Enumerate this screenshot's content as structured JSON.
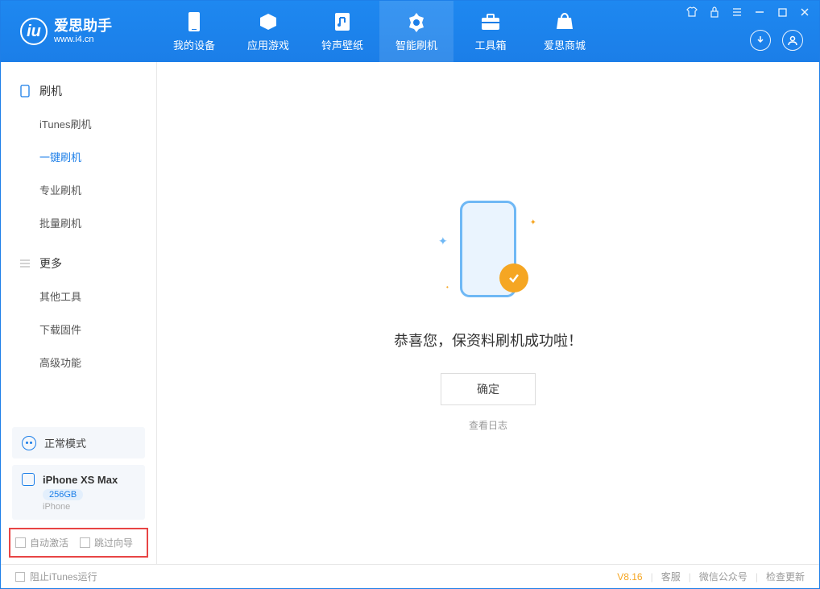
{
  "logo": {
    "title": "爱思助手",
    "url": "www.i4.cn"
  },
  "nav": {
    "tabs": [
      {
        "label": "我的设备",
        "icon": "device-icon"
      },
      {
        "label": "应用游戏",
        "icon": "apps-icon"
      },
      {
        "label": "铃声壁纸",
        "icon": "ringtone-icon"
      },
      {
        "label": "智能刷机",
        "icon": "flash-icon",
        "active": true
      },
      {
        "label": "工具箱",
        "icon": "toolbox-icon"
      },
      {
        "label": "爱思商城",
        "icon": "store-icon"
      }
    ]
  },
  "sidebar": {
    "group1": {
      "title": "刷机"
    },
    "items1": [
      {
        "label": "iTunes刷机"
      },
      {
        "label": "一键刷机",
        "active": true
      },
      {
        "label": "专业刷机"
      },
      {
        "label": "批量刷机"
      }
    ],
    "group2": {
      "title": "更多"
    },
    "items2": [
      {
        "label": "其他工具"
      },
      {
        "label": "下载固件"
      },
      {
        "label": "高级功能"
      }
    ],
    "mode": {
      "label": "正常模式"
    },
    "device": {
      "name": "iPhone XS Max",
      "capacity": "256GB",
      "type": "iPhone"
    },
    "checkboxes": {
      "auto_activate": "自动激活",
      "skip_guide": "跳过向导"
    }
  },
  "main": {
    "success_title": "恭喜您，保资料刷机成功啦！",
    "ok_button": "确定",
    "view_log": "查看日志"
  },
  "footer": {
    "block_itunes": "阻止iTunes运行",
    "version": "V8.16",
    "support": "客服",
    "wechat": "微信公众号",
    "check_update": "检查更新"
  }
}
